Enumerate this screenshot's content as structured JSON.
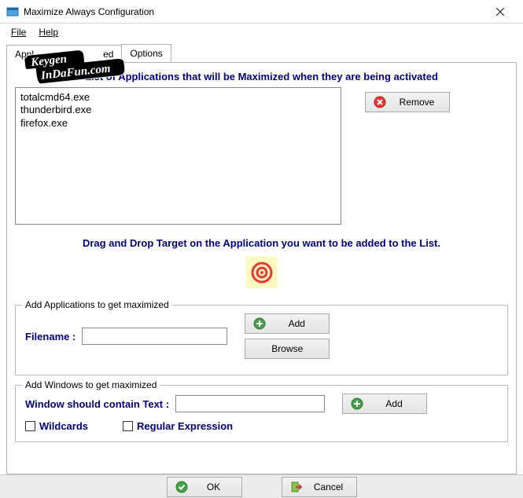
{
  "window": {
    "title": "Maximize Always Configuration"
  },
  "menu": {
    "file": "File",
    "help": "Help"
  },
  "tabs": {
    "apps": "Appl",
    "apps_suffix": "ed",
    "options": "Options"
  },
  "main": {
    "list_title": "List of Applications that will be Maximized when they are being activated",
    "apps": [
      "totalcmd64.exe",
      "thunderbird.exe",
      "firefox.exe"
    ],
    "remove": "Remove",
    "drag_hint": "Drag and Drop Target on the Application you want to be added to the List."
  },
  "add_app": {
    "legend": "Add Applications to get maximized",
    "filename_label": "Filename :",
    "filename_value": "",
    "add": "Add",
    "browse": "Browse"
  },
  "add_win": {
    "legend": "Add Windows to get maximized",
    "text_label": "Window should contain Text :",
    "text_value": "",
    "add": "Add",
    "wildcards": "Wildcards",
    "regex": "Regular Expression"
  },
  "buttons": {
    "ok": "OK",
    "cancel": "Cancel"
  },
  "watermark": {
    "line1": "Keygen",
    "line2": "InDaFun.com"
  }
}
